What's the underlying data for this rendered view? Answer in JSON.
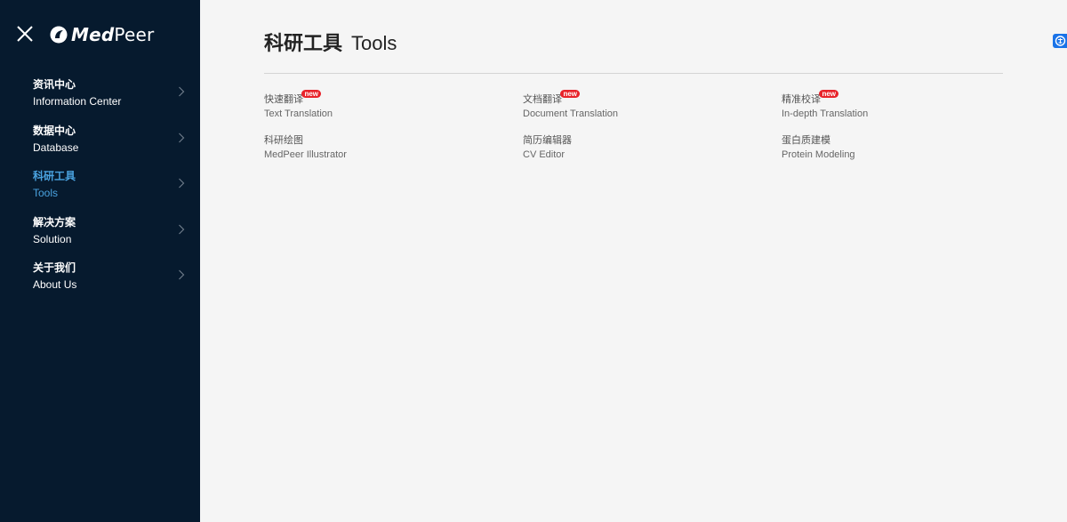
{
  "brand": {
    "name_bold": "Med",
    "name_rest": "Peer"
  },
  "nav": [
    {
      "zh": "资讯中心",
      "en": "Information Center",
      "active": false
    },
    {
      "zh": "数据中心",
      "en": "Database",
      "active": false
    },
    {
      "zh": "科研工具",
      "en": "Tools",
      "active": true
    },
    {
      "zh": "解决方案",
      "en": "Solution",
      "active": false
    },
    {
      "zh": "关于我们",
      "en": "About Us",
      "active": false
    }
  ],
  "page": {
    "title_zh": "科研工具",
    "title_en": "Tools"
  },
  "tools": [
    {
      "zh": "快速翻译",
      "en": "Text Translation",
      "badge": "new"
    },
    {
      "zh": "文档翻译",
      "en": "Document Translation",
      "badge": "new"
    },
    {
      "zh": "精准校译",
      "en": "In-depth Translation",
      "badge": "new"
    },
    {
      "zh": "科研绘图",
      "en": "MedPeer Illustrator",
      "badge": ""
    },
    {
      "zh": "简历编辑器",
      "en": "CV Editor",
      "badge": ""
    },
    {
      "zh": "蛋白质建模",
      "en": "Protein Modeling",
      "badge": ""
    }
  ],
  "colors": {
    "sidebar": "#061a2e",
    "active": "#4aa3e0",
    "badge": "#e8232a",
    "background": "#f5f5f5"
  },
  "icons": {
    "close": "close-icon",
    "logo": "medpeer-logo-icon",
    "chevron": "chevron-right-icon",
    "widget": "translate-widget-icon"
  }
}
